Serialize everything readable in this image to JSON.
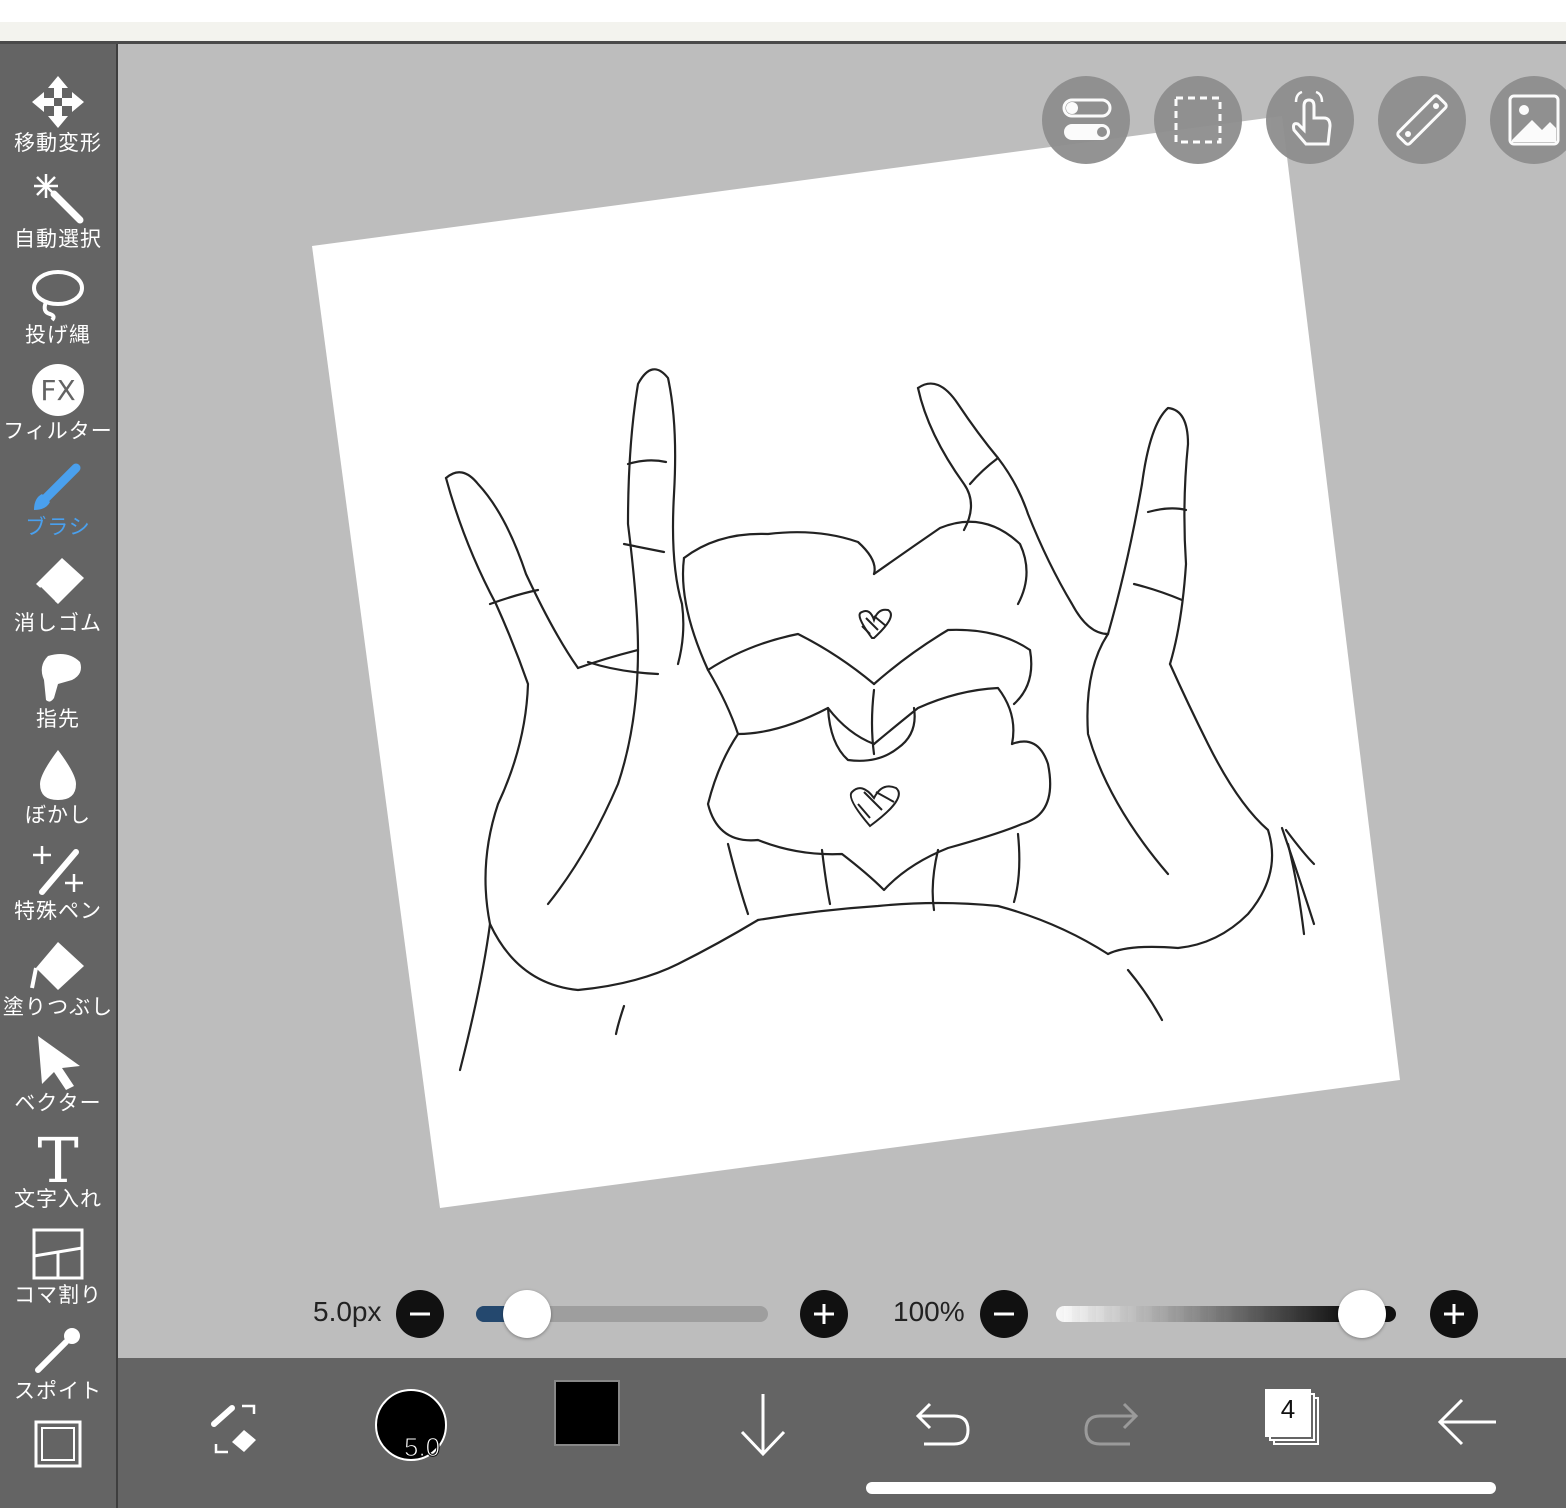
{
  "tools": [
    {
      "id": "move",
      "label": "移動変形",
      "icon": "move-arrows-icon",
      "active": false
    },
    {
      "id": "autoselect",
      "label": "自動選択",
      "icon": "magic-wand-icon",
      "active": false
    },
    {
      "id": "lasso",
      "label": "投げ縄",
      "icon": "lasso-icon",
      "active": false
    },
    {
      "id": "filter",
      "label": "フィルター",
      "icon": "fx-icon",
      "active": false
    },
    {
      "id": "brush",
      "label": "ブラシ",
      "icon": "brush-icon",
      "active": true
    },
    {
      "id": "eraser",
      "label": "消しゴム",
      "icon": "eraser-icon",
      "active": false
    },
    {
      "id": "finger",
      "label": "指先",
      "icon": "finger-smudge-icon",
      "active": false
    },
    {
      "id": "blur",
      "label": "ぼかし",
      "icon": "drop-icon",
      "active": false
    },
    {
      "id": "special",
      "label": "特殊ペン",
      "icon": "sparkle-pen-icon",
      "active": false
    },
    {
      "id": "fill",
      "label": "塗りつぶし",
      "icon": "bucket-icon",
      "active": false
    },
    {
      "id": "vector",
      "label": "ベクター",
      "icon": "cursor-arrow-icon",
      "active": false
    },
    {
      "id": "text",
      "label": "文字入れ",
      "icon": "text-t-icon",
      "active": false
    },
    {
      "id": "frame",
      "label": "コマ割り",
      "icon": "panel-divide-icon",
      "active": false
    },
    {
      "id": "eyedropper",
      "label": "スポイト",
      "icon": "eyedropper-icon",
      "active": false
    },
    {
      "id": "canvas",
      "label": "",
      "icon": "canvas-frame-icon",
      "active": false
    }
  ],
  "top_buttons": [
    "toggle-switches-icon",
    "dashed-selection-icon",
    "touch-hand-icon",
    "ruler-icon",
    "image-material-icon"
  ],
  "brush_size": {
    "label": "5.0px",
    "value_fraction": 0.07
  },
  "opacity": {
    "label": "100%",
    "value_fraction": 1.0
  },
  "bottom_bar": {
    "brush_preview_label": "5.0",
    "current_color": "#000000",
    "layers_count": "4"
  },
  "colors": {
    "toolbar_bg": "#646464",
    "canvas_bg": "#bdbdbd",
    "active_tool": "#4aa0ee"
  }
}
